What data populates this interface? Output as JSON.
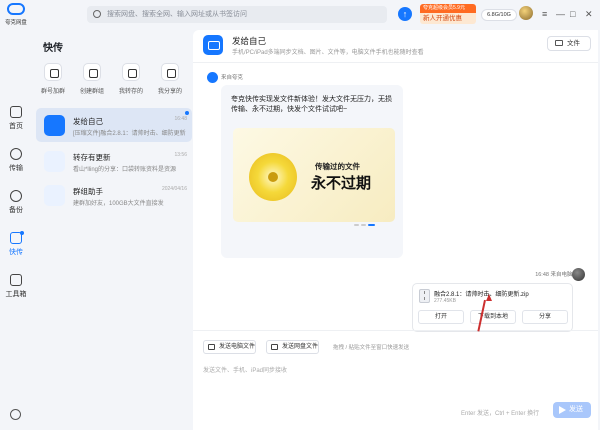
{
  "app": {
    "logo_text": "夸克网盘",
    "search_placeholder": "搜索网盘、搜索全网、输入网址或从书签访问",
    "promo_top": "夸克超级会员5.9元",
    "promo_bottom": "新人开通优惠",
    "storage": "6.8G/10G",
    "window_controls": [
      "≡",
      "—",
      "□",
      "✕"
    ]
  },
  "rail": {
    "items": [
      {
        "label": "首页",
        "icon": "home-icon"
      },
      {
        "label": "传输",
        "icon": "transfer-icon"
      },
      {
        "label": "备份",
        "icon": "backup-icon"
      },
      {
        "label": "快传",
        "icon": "quick-share-icon"
      },
      {
        "label": "工具箱",
        "icon": "toolbox-icon"
      }
    ]
  },
  "panel": {
    "title": "快传",
    "quick_actions": [
      {
        "label": "群号加群",
        "icon": "join-group-icon"
      },
      {
        "label": "创建群组",
        "icon": "create-group-icon"
      },
      {
        "label": "我转存的",
        "icon": "saved-icon"
      },
      {
        "label": "我分享的",
        "icon": "shared-icon"
      }
    ],
    "conversations": [
      {
        "name": "发给自己",
        "sub": "[压缩文件]融合2.8.1：请帅时击、细防更新.zip",
        "time": "16:48",
        "icon": "monitor-icon"
      },
      {
        "name": "转存有更新",
        "sub": "看山*lling的分享：口袋转账资料是资源",
        "time": "13:56",
        "icon": "cloud-update-icon"
      },
      {
        "name": "群组助手",
        "sub": "建群加好友，100GB大文件直接发",
        "time": "2024/04/16",
        "icon": "group-helper-icon"
      }
    ]
  },
  "main": {
    "title": "发给自己",
    "subtitle": "手机/PC/iPad多端同步文档、图片、文件等，电脑文件手机也能随时查看",
    "file_button": "文件",
    "incoming": {
      "sender": "来自夸克",
      "text": "夸克快传实现发文件新体验！发大文件无压力，无损传输、永不过期，快发个文件试试吧~",
      "banner_line1": "传输过的文件",
      "banner_line2": "永不过期"
    },
    "outgoing": {
      "time": "16:48",
      "sender": "来自电脑端",
      "file_name": "融合2.8.1：请帅时击、细防更新.zip",
      "file_size": "277.45KB",
      "buttons": [
        "打开",
        "下载到本地",
        "分享"
      ]
    },
    "compose": {
      "btn_pc_file": "发送电脑文件",
      "btn_cloud_file": "发送网盘文件",
      "hint": "拖拽 / 粘贴文件至窗口快速发送",
      "placeholder": "发送文件、手机、iPad同步接收",
      "send_hint": "Enter 发送，Ctrl + Enter 换行",
      "send_label": "发送"
    }
  }
}
